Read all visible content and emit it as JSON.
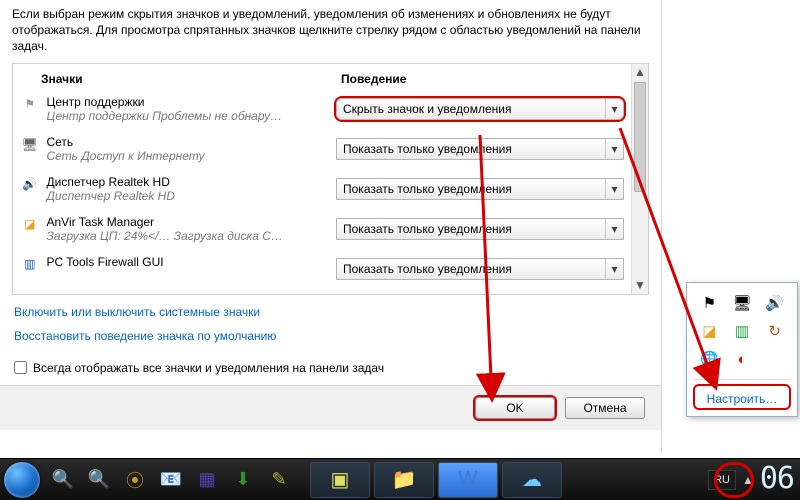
{
  "intro": "Если выбран режим скрытия значков и уведомлений, уведомления об изменениях и обновлениях не будут отображаться. Для просмотра спрятанных значков щелкните стрелку рядом с областью уведомлений на панели задач.",
  "cols": {
    "icons": "Значки",
    "behavior": "Поведение"
  },
  "rows": [
    {
      "icon": "ic-flag",
      "title": "Центр поддержки",
      "sub": "Центр поддержки  Проблемы не обнару…",
      "dd": "Скрыть значок и уведомления",
      "highlight": true
    },
    {
      "icon": "ic-net",
      "title": "Сеть",
      "sub": "Сеть Доступ к Интернету",
      "dd": "Показать только уведомления"
    },
    {
      "icon": "ic-spk",
      "title": "Диспетчер Realtek HD",
      "sub": "Диспетчер Realtek HD",
      "dd": "Показать только уведомления"
    },
    {
      "icon": "ic-anv",
      "title": "AnVir Task Manager",
      "sub": "Загрузка ЦП: 24%</…   Загрузка диска  С…",
      "dd": "Показать только уведомления"
    },
    {
      "icon": "ic-fw",
      "title": "PC Tools Firewall GUI",
      "sub": "",
      "dd": "Показать только уведомления"
    }
  ],
  "links": {
    "sysIcons": "Включить или выключить системные значки",
    "restore": "Восстановить поведение значка по умолчанию"
  },
  "checkbox": "Всегда отображать все значки и уведомления на панели задач",
  "buttons": {
    "ok": "OK",
    "cancel": "Отмена"
  },
  "tray": {
    "customize": "Настроить…"
  },
  "taskbar": {
    "lang": "RU",
    "clock": "06"
  }
}
